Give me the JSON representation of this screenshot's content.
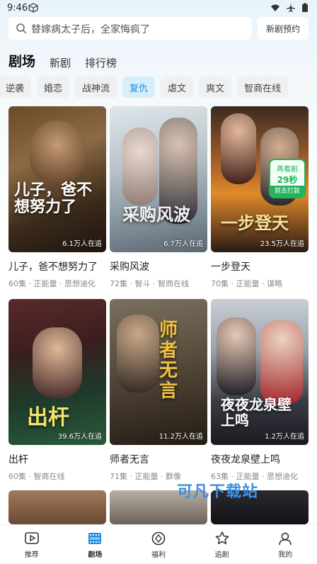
{
  "status_bar": {
    "time": "9:46"
  },
  "search": {
    "placeholder": "替嫁病太子后，全家悔疯了",
    "reserve_label": "新剧预约"
  },
  "top_tabs": [
    {
      "label": "剧场",
      "active": true
    },
    {
      "label": "新剧",
      "active": false
    },
    {
      "label": "排行榜",
      "active": false
    }
  ],
  "genres": [
    {
      "label": "逆袭",
      "active": false
    },
    {
      "label": "婚恋",
      "active": false
    },
    {
      "label": "战神流",
      "active": false
    },
    {
      "label": "复仇",
      "active": true
    },
    {
      "label": "虐文",
      "active": false
    },
    {
      "label": "爽文",
      "active": false
    },
    {
      "label": "智商在线",
      "active": false
    }
  ],
  "dramas": [
    {
      "title": "儿子，爸不想努力了",
      "meta": "60集 · 正能量 · 思想迪化",
      "watching": "6.1万人在追",
      "poster_text": "儿子，爸不想努力了"
    },
    {
      "title": "采购风波",
      "meta": "72集 · 智斗 · 智商在线",
      "watching": "6.7万人在追",
      "poster_text": "采购风波"
    },
    {
      "title": "一步登天",
      "meta": "70集 · 正能量 · 谋略",
      "watching": "23.5万人在追",
      "poster_text": "一步登天"
    },
    {
      "title": "出杆",
      "meta": "60集 · 智商在线",
      "watching": "39.6万人在追",
      "poster_text": "出杆"
    },
    {
      "title": "师者无言",
      "meta": "71集 · 正能量 · 群像",
      "watching": "11.2万人在追",
      "poster_text": "师者无言"
    },
    {
      "title": "夜夜龙泉壁上鸣",
      "meta": "63集 · 正能量 · 思想迪化",
      "watching": "1.2万人在追",
      "poster_text": "夜夜龙泉壁上鸣"
    }
  ],
  "ad_badge": {
    "line1": "再看剧",
    "line2": "29秒",
    "line3": "就去打款"
  },
  "watermark": "可凡下载站",
  "bottom_nav": [
    {
      "label": "推荐",
      "icon": "play-icon",
      "active": false
    },
    {
      "label": "剧场",
      "icon": "film-icon",
      "active": true
    },
    {
      "label": "福利",
      "icon": "gift-icon",
      "active": false
    },
    {
      "label": "追剧",
      "icon": "star-icon",
      "active": false
    },
    {
      "label": "我的",
      "icon": "user-icon",
      "active": false
    }
  ],
  "colors": {
    "accent": "#1b8fe0",
    "badge_green": "#22b35a"
  }
}
